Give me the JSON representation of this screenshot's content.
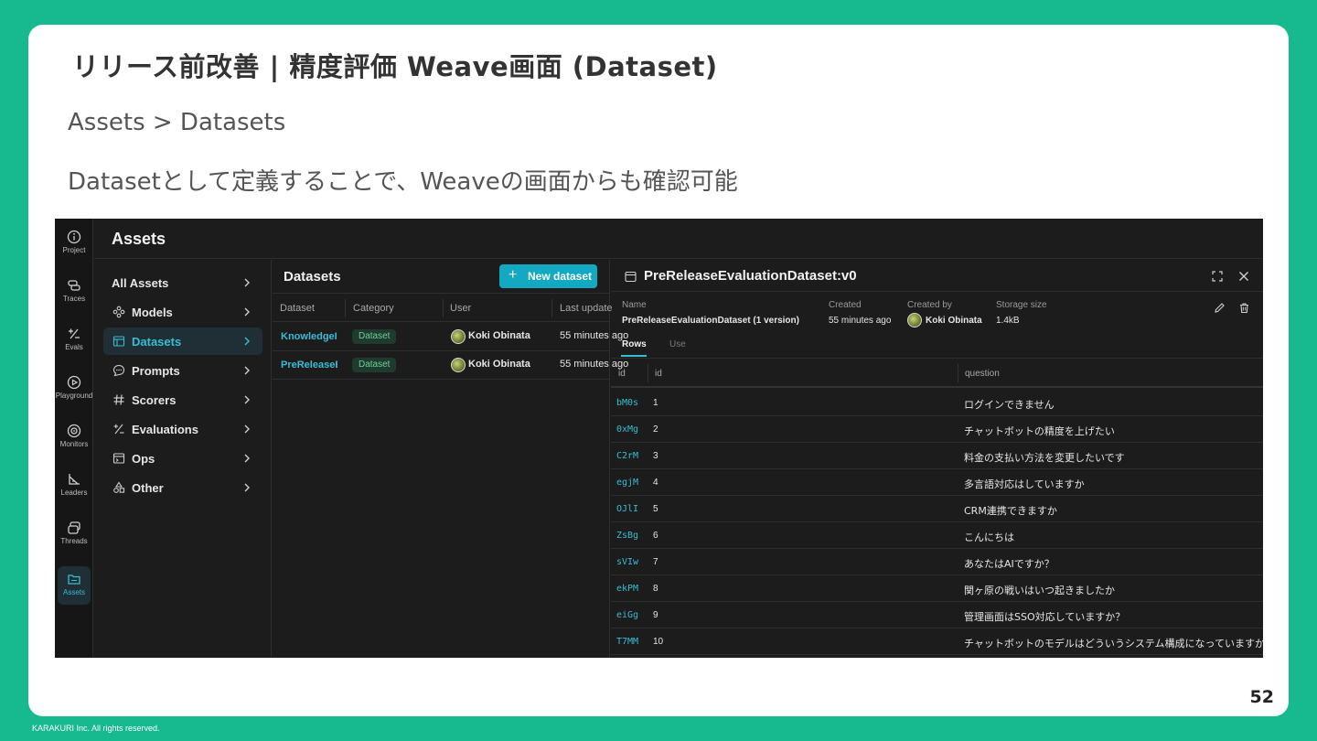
{
  "slide": {
    "title": "リリース前改善 | 精度評価 Weave画面 (Dataset)",
    "subtitle": "Assets > Datasets",
    "description": "Datasetとして定義することで、Weaveの画面からも確認可能",
    "page_number": "52",
    "copyright": "KARAKURI Inc. All rights reserved."
  },
  "rail": [
    {
      "label": "Project",
      "icon": "info-icon"
    },
    {
      "label": "Traces",
      "icon": "layers-icon"
    },
    {
      "label": "Evals",
      "icon": "plus-minus-icon"
    },
    {
      "label": "Playground",
      "icon": "play-icon"
    },
    {
      "label": "Monitors",
      "icon": "monitor-icon"
    },
    {
      "label": "Leaders",
      "icon": "leaderboard-icon"
    },
    {
      "label": "Threads",
      "icon": "threads-icon"
    },
    {
      "label": "Assets",
      "icon": "folder-icon",
      "active": true
    }
  ],
  "topbar": {
    "title": "Assets"
  },
  "nav": [
    {
      "label": "All Assets"
    },
    {
      "label": "Models",
      "icon": "models-icon"
    },
    {
      "label": "Datasets",
      "icon": "table-icon",
      "active": true
    },
    {
      "label": "Prompts",
      "icon": "chat-icon"
    },
    {
      "label": "Scorers",
      "icon": "hash-icon"
    },
    {
      "label": "Evaluations",
      "icon": "plus-minus-icon"
    },
    {
      "label": "Ops",
      "icon": "ops-icon"
    },
    {
      "label": "Other",
      "icon": "shapes-icon"
    }
  ],
  "datasets_panel": {
    "title": "Datasets",
    "new_button": "New dataset",
    "columns": [
      "Dataset",
      "Category",
      "User",
      "Last update"
    ],
    "rows": [
      {
        "name": "KnowledgeItemsDataset",
        "category": "Dataset",
        "user": "Koki Obinata",
        "updated": "55 minutes ago"
      },
      {
        "name": "PreReleaseEvaluationDataset",
        "category": "Dataset",
        "user": "Koki Obinata",
        "updated": "55 minutes ago"
      }
    ]
  },
  "detail": {
    "title": "PreReleaseEvaluationDataset:v0",
    "meta": {
      "name_label": "Name",
      "name": "PreReleaseEvaluationDataset (1 version)",
      "created_label": "Created",
      "created": "55 minutes ago",
      "created_by_label": "Created by",
      "created_by": "Koki Obinata",
      "size_label": "Storage size",
      "size": "1.4kB"
    },
    "tabs": [
      "Rows",
      "Use"
    ],
    "columns": [
      "id",
      "id",
      "question"
    ],
    "rows": [
      {
        "rid": "bM0s",
        "id": "1",
        "question": "ログインできません"
      },
      {
        "rid": "0xMg",
        "id": "2",
        "question": "チャットボットの精度を上げたい"
      },
      {
        "rid": "C2rM",
        "id": "3",
        "question": "料金の支払い方法を変更したいです"
      },
      {
        "rid": "egjM",
        "id": "4",
        "question": "多言語対応はしていますか"
      },
      {
        "rid": "OJlI",
        "id": "5",
        "question": "CRM連携できますか"
      },
      {
        "rid": "ZsBg",
        "id": "6",
        "question": "こんにちは"
      },
      {
        "rid": "sVIw",
        "id": "7",
        "question": "あなたはAIですか？"
      },
      {
        "rid": "ekPM",
        "id": "8",
        "question": "関ヶ原の戦いはいつ起きましたか"
      },
      {
        "rid": "eiGg",
        "id": "9",
        "question": "管理画面はSSO対応していますか？"
      },
      {
        "rid": "T7MM",
        "id": "10",
        "question": "チャットボットのモデルはどういうシステム構成になっていますか"
      }
    ]
  }
}
